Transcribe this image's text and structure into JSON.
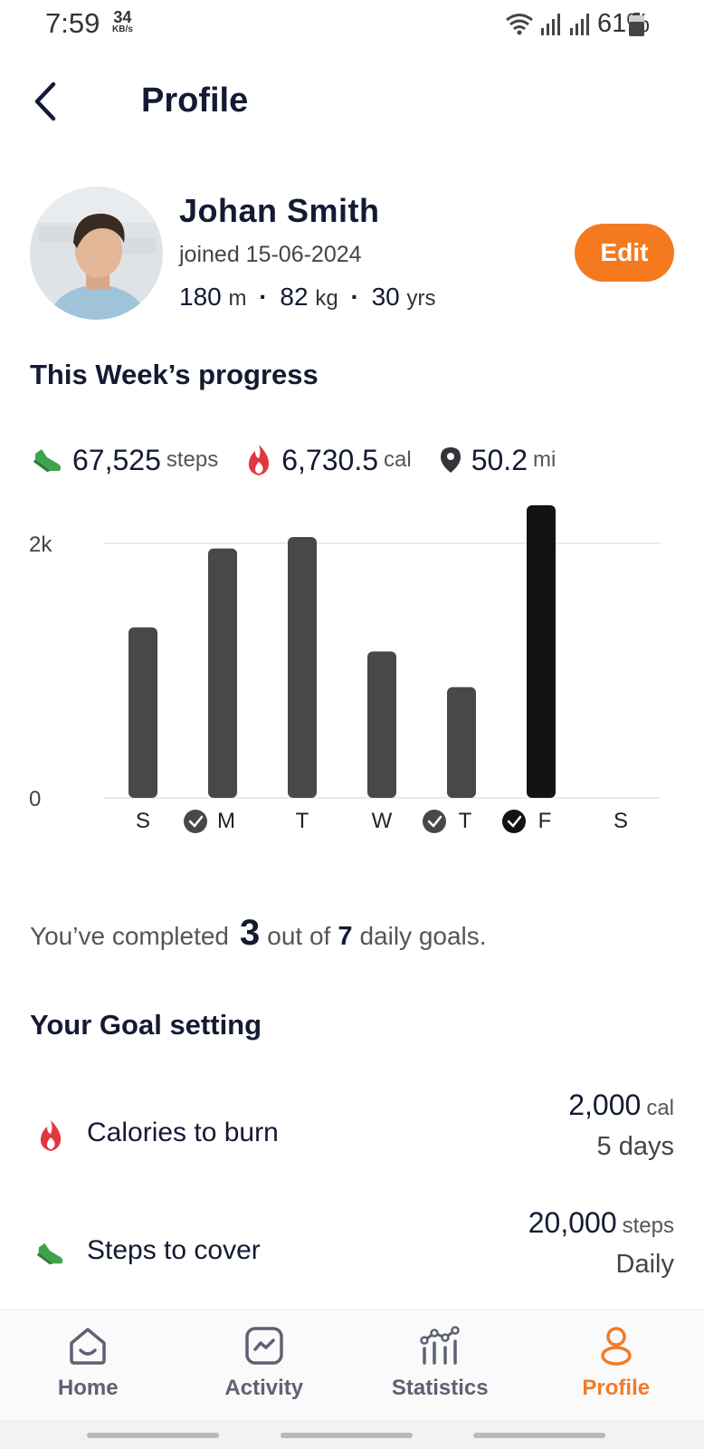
{
  "status_bar": {
    "time": "7:59",
    "net_speed": "34",
    "net_speed_unit": "KB/s",
    "battery": "61%"
  },
  "header": {
    "title": "Profile",
    "back_icon": "chevron-left-icon"
  },
  "profile": {
    "name": "Johan Smith",
    "joined": "joined 15-06-2024",
    "height": "180",
    "height_unit": "m",
    "weight": "82",
    "weight_unit": "kg",
    "age": "30",
    "age_unit": "yrs",
    "edit_label": "Edit"
  },
  "progress": {
    "title": "This Week’s progress",
    "steps": "67,525",
    "steps_unit": "steps",
    "calories": "6,730.5",
    "calories_unit": "cal",
    "distance": "50.2",
    "distance_unit": "mi",
    "completed_prefix": "You’ve completed",
    "completed_count": "3",
    "completed_mid": "out of",
    "completed_total": "7",
    "completed_suffix": "daily goals.",
    "colors": {
      "bar": "#4a474b",
      "bar_highlight": "#141214",
      "accent": "#f57a1f"
    }
  },
  "chart_data": {
    "type": "bar",
    "categories": [
      "S",
      "M",
      "T",
      "W",
      "T",
      "F",
      "S"
    ],
    "values": [
      1340,
      1960,
      2050,
      1150,
      870,
      2300,
      0
    ],
    "goal_met": [
      false,
      true,
      false,
      false,
      true,
      true,
      false
    ],
    "highlight_index": 5,
    "y_tick_labels": [
      "0",
      "2k"
    ],
    "y_ticks": [
      0,
      2000
    ],
    "ylim": [
      0,
      2000
    ],
    "grid": true
  },
  "goals": {
    "title": "Your Goal setting",
    "items": [
      {
        "label": "Calories to burn",
        "value": "2,000",
        "unit": "cal",
        "frequency": "5 days",
        "icon": "flame-icon"
      },
      {
        "label": "Steps to cover",
        "value": "20,000",
        "unit": "steps",
        "frequency": "Daily",
        "icon": "shoe-icon"
      }
    ]
  },
  "nav": {
    "items": [
      {
        "label": "Home",
        "icon": "home-icon"
      },
      {
        "label": "Activity",
        "icon": "activity-icon"
      },
      {
        "label": "Statistics",
        "icon": "statistics-icon"
      },
      {
        "label": "Profile",
        "icon": "profile-icon"
      }
    ],
    "active_color": "#f07c2a",
    "inactive_color": "#5d6272"
  }
}
